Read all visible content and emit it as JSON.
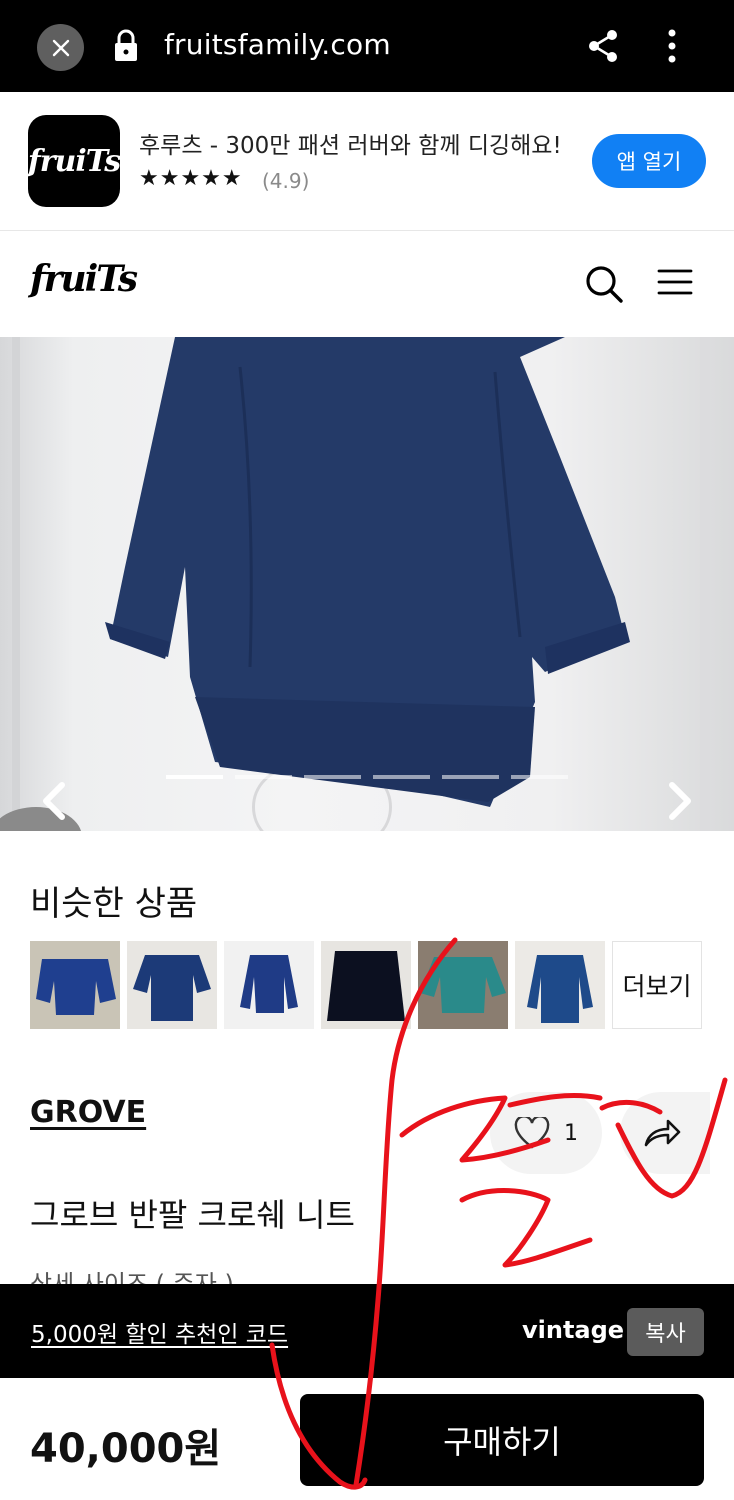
{
  "browser": {
    "url": "fruitsfamily.com"
  },
  "app_banner": {
    "logo_text": "fruiTs",
    "title": "후루츠 - 300만 패션 러버와 함께 디깅해요!",
    "stars": "★★★★★",
    "rating": "(4.9)",
    "open_label": "앱 열기"
  },
  "header": {
    "logo_text": "fruiTs"
  },
  "carousel": {
    "slide_count": 6,
    "active_index": 0
  },
  "similar": {
    "title": "비슷한 상품",
    "more_label": "더보기",
    "thumbs": [
      {
        "bg": "#c9c4b6",
        "color": "#1f3f8f"
      },
      {
        "bg": "#e8e6e2",
        "color": "#1c3a78"
      },
      {
        "bg": "#f1f1f1",
        "color": "#1f3b86"
      },
      {
        "bg": "#e7e5e1",
        "color": "#0c1020"
      },
      {
        "bg": "#8a7d70",
        "color": "#2a8a8a"
      },
      {
        "bg": "#eceae6",
        "color": "#1e4a8a"
      }
    ]
  },
  "product": {
    "brand": "GROVE",
    "like_count": "1",
    "name": "그로브 반팔 크로쉐 니트",
    "detail_label": "상세 사이즈 ( 주자 )"
  },
  "referral": {
    "text": "5,000원 할인 추천인 코드",
    "code": "vintage",
    "copy_label": "복사"
  },
  "purchase": {
    "price": "40,000원",
    "buy_label": "구매하기"
  },
  "colors": {
    "accent_blue": "#1180f4",
    "sweater_navy": "#243a68",
    "annotation_red": "#e8121b"
  }
}
